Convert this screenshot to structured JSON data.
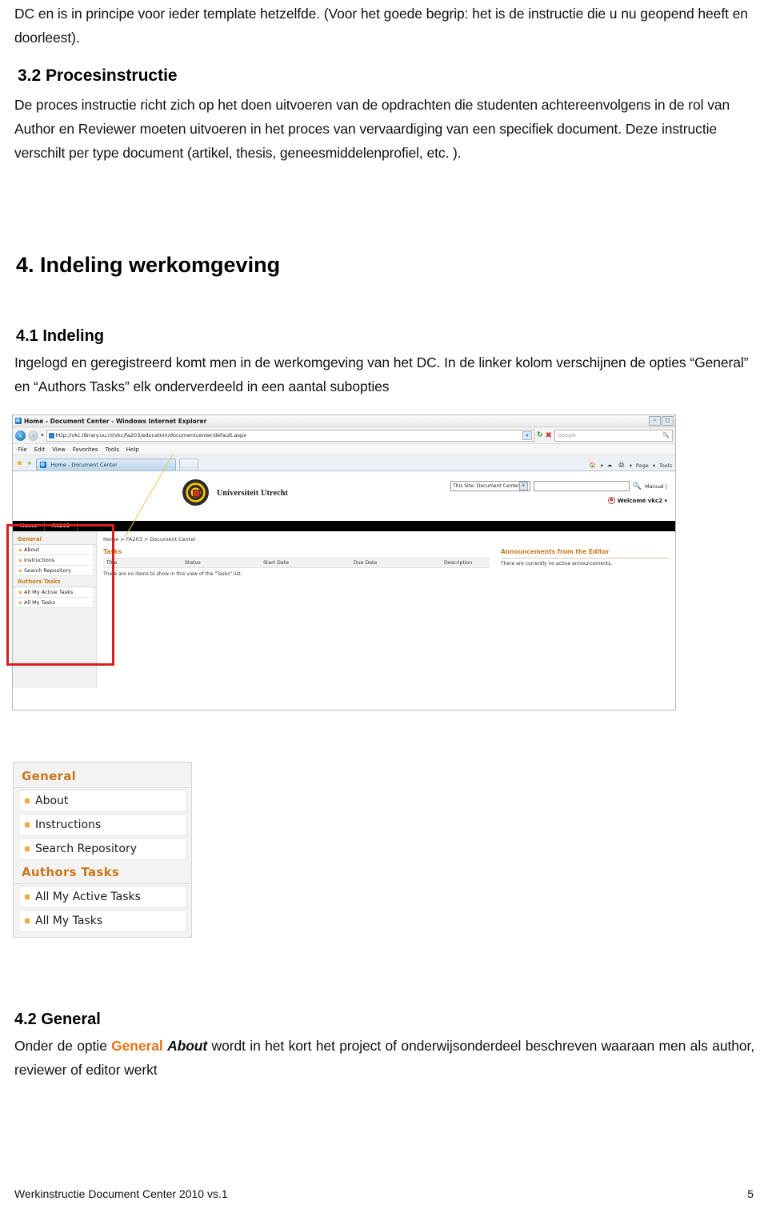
{
  "document": {
    "intro_paragraph": "DC en is in principe voor ieder template hetzelfde. (Voor het goede begrip: het is de instructie die u nu geopend heeft en doorleest).",
    "section_3_2": {
      "heading": "3.2 Procesinstructie",
      "body": "De proces instructie richt zich op het doen uitvoeren van de opdrachten die studenten achtereenvolgens in de rol van Author en Reviewer moeten uitvoeren in het proces van vervaardiging van een specifiek document. Deze instructie verschilt per type document (artikel, thesis, geneesmiddelenprofiel, etc. )."
    },
    "section_4": {
      "heading": "4.  Indeling werkomgeving"
    },
    "section_4_1": {
      "heading": "4.1 Indeling",
      "body": "Ingelogd en geregistreerd komt men in de werkomgeving van het DC. In de linker kolom verschijnen de opties “General” en “Authors Tasks” elk onderverdeeld in een aantal subopties"
    },
    "section_4_2": {
      "heading": "4.2 General",
      "body_before": "Onder de optie ",
      "body_general": "General",
      "body_about": "About",
      "body_after": " wordt in het kort het project of onderwijsonderdeel beschreven waaraan men als author, reviewer of editor werkt"
    },
    "footer": {
      "left": "Werkinstructie Document Center 2010 vs.1",
      "page_number": "5"
    }
  },
  "screenshot": {
    "window_title": "Home - Document Center - Windows Internet Explorer",
    "window_buttons": [
      "–",
      "□"
    ],
    "address": {
      "url": "http://vkc.library.uu.nl/vkc/fa203/education/documentcenter/default.aspx",
      "search_placeholder": "Google"
    },
    "menu_items": [
      "File",
      "Edit",
      "View",
      "Favorites",
      "Tools",
      "Help"
    ],
    "tab_label": "Home - Document Center",
    "command_bar": [
      "Page",
      "Tools"
    ],
    "site_header": {
      "org_name": "Universiteit Utrecht",
      "search_scope": "This Site: Document Center",
      "manual_link": "Manual |",
      "welcome": "Welcome vkc2 ▾"
    },
    "top_nav": [
      "Home",
      "FA203"
    ],
    "quick_launch": [
      {
        "type": "header",
        "label": "General"
      },
      {
        "type": "item",
        "label": "About"
      },
      {
        "type": "item",
        "label": "Instructions"
      },
      {
        "type": "item",
        "label": "Search Repository"
      },
      {
        "type": "header",
        "label": "Authors Tasks"
      },
      {
        "type": "item",
        "label": "All My Active Tasks"
      },
      {
        "type": "item",
        "label": "All My Tasks"
      }
    ],
    "breadcrumb": "Home > FA203 > Document Center",
    "tasks": {
      "title": "Tasks",
      "columns": [
        "Title",
        "Status",
        "Start Date",
        "Due Date",
        "Description"
      ],
      "rows": [],
      "empty_message": "There are no items to show in this view of the \"Tasks\" list."
    },
    "announcements": {
      "title": "Announcements from the Editor",
      "empty_message": "There are currently no active announcements."
    },
    "highlight_color": "#d61f1f"
  },
  "figure_sidebar": {
    "items": [
      {
        "type": "header",
        "label": "General"
      },
      {
        "type": "item",
        "label": "About"
      },
      {
        "type": "item",
        "label": "Instructions"
      },
      {
        "type": "item",
        "label": "Search Repository"
      },
      {
        "type": "header",
        "label": "Authors Tasks"
      },
      {
        "type": "item",
        "label": "All My Active Tasks"
      },
      {
        "type": "item",
        "label": "All My Tasks"
      }
    ],
    "header_color": "#c8791b",
    "bullet_color": "#f2a93b"
  }
}
